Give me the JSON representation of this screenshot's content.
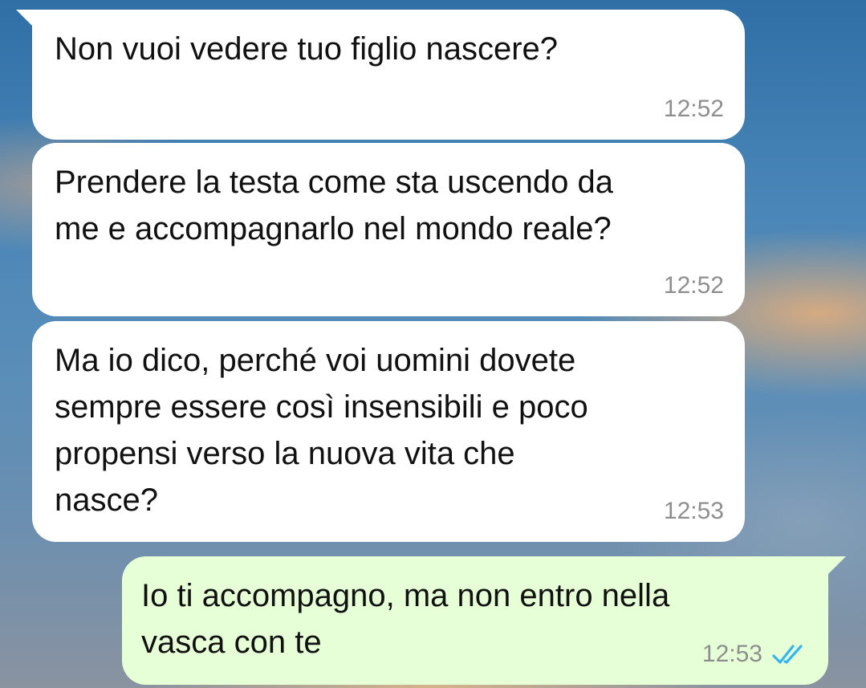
{
  "messages": [
    {
      "direction": "incoming",
      "text": "Non vuoi vedere tuo figlio nascere?",
      "time": "12:52"
    },
    {
      "direction": "incoming",
      "text": "Prendere la testa come sta uscendo da\nme e accompagnarlo nel mondo reale?",
      "time": "12:52"
    },
    {
      "direction": "incoming",
      "text": "Ma io dico, perché voi uomini dovete\nsempre essere così insensibili e poco\npropensi verso la nuova vita che\nnasce?",
      "time": "12:53"
    },
    {
      "direction": "outgoing",
      "text": "Io ti accompagno, ma non entro nella\nvasca con te",
      "time": "12:53",
      "status_icon": "double-check-read-icon",
      "status_color": "#34b7f1"
    }
  ],
  "colors": {
    "incoming_bubble": "#ffffff",
    "outgoing_bubble": "#e6ffd6",
    "timestamp": "#8e8e8e",
    "read_receipt": "#34b7f1"
  }
}
